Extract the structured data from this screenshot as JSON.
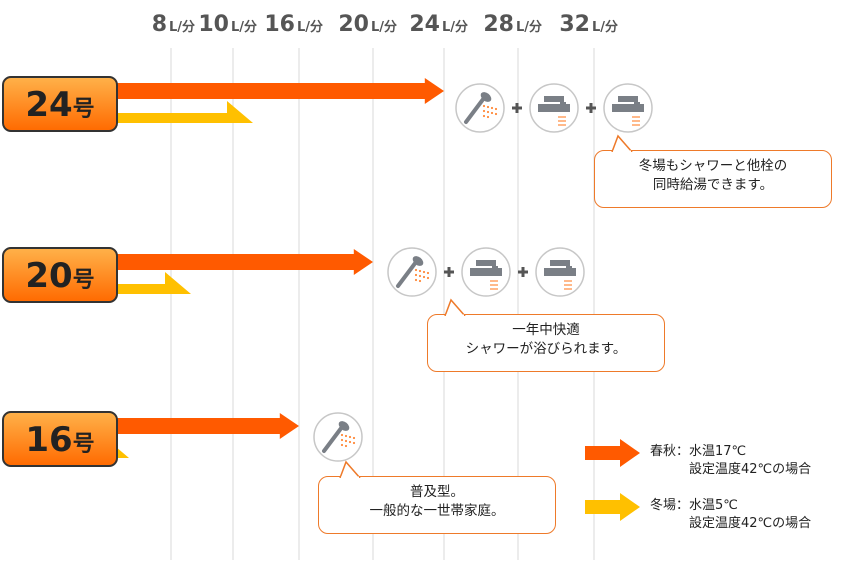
{
  "chart_data": {
    "type": "bar",
    "unit": "L/分",
    "x_ticks": [
      8,
      10,
      16,
      20,
      24,
      28,
      32
    ],
    "categories": [
      "24号",
      "20号",
      "16号"
    ],
    "series": [
      {
        "name": "春秋：水温17℃\n設定温度42℃の場合",
        "color": "#ff5a00",
        "values": [
          24,
          20,
          16
        ]
      },
      {
        "name": "冬場：水温5℃\n設定温度42℃の場合",
        "color": "#ffc000",
        "values": [
          10,
          8,
          6
        ]
      }
    ],
    "annotations": [
      {
        "category": "24号",
        "text": [
          "冬場もシャワーと他栓の",
          "同時給湯できます。"
        ],
        "icons": [
          "shower-icon",
          "faucet-icon",
          "faucet-icon"
        ]
      },
      {
        "category": "20号",
        "text": [
          "一年中快適",
          "シャワーが浴びられます。"
        ],
        "icons": [
          "shower-icon",
          "faucet-icon",
          "faucet-icon"
        ]
      },
      {
        "category": "16号",
        "text": [
          "普及型。",
          "一般的な一世帯家庭。"
        ],
        "icons": [
          "shower-icon"
        ]
      }
    ]
  },
  "colors": {
    "badge_top": "#ffb24a",
    "badge_bottom": "#ff6a00",
    "badge_border": "#333333",
    "bubble_border": "#ee7a2a",
    "grid": "#d8d8d8",
    "icon": "#7a7f86"
  }
}
